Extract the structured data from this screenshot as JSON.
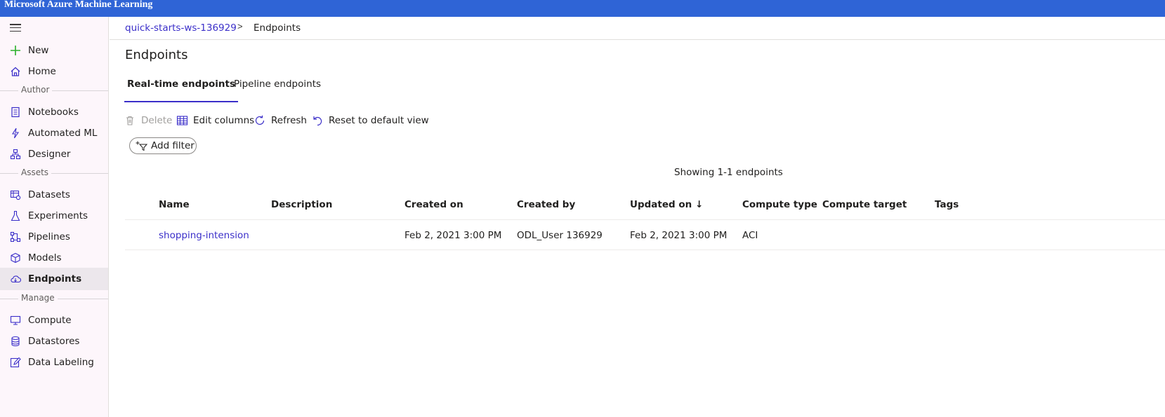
{
  "app": {
    "title": "Microsoft Azure Machine Learning"
  },
  "sidebar": {
    "new_label": "New",
    "home_label": "Home",
    "sections": {
      "author": "Author",
      "assets": "Assets",
      "manage": "Manage"
    },
    "author_items": [
      "Notebooks",
      "Automated ML",
      "Designer"
    ],
    "asset_items": [
      "Datasets",
      "Experiments",
      "Pipelines",
      "Models",
      "Endpoints"
    ],
    "manage_items": [
      "Compute",
      "Datastores",
      "Data Labeling"
    ],
    "active_item": "Endpoints"
  },
  "breadcrumb": {
    "workspace": "quick-starts-ws-136929",
    "separator": ">",
    "current": "Endpoints"
  },
  "page": {
    "title": "Endpoints"
  },
  "tabs": [
    {
      "label": "Real-time endpoints",
      "active": true
    },
    {
      "label": "Pipeline endpoints",
      "active": false
    }
  ],
  "toolbar": {
    "delete": "Delete",
    "edit_columns": "Edit columns",
    "refresh": "Refresh",
    "reset": "Reset to default view"
  },
  "filter": {
    "add_filter": "Add filter"
  },
  "table": {
    "showing": "Showing 1-1 endpoints",
    "columns": [
      "Name",
      "Description",
      "Created on",
      "Created by",
      "Updated on ↓",
      "Compute type",
      "Compute target",
      "Tags"
    ],
    "rows": [
      [
        "shopping-intension",
        "",
        "Feb 2, 2021 3:00 PM",
        "ODL_User 136929",
        "Feb 2, 2021 3:00 PM",
        "ACI",
        "",
        ""
      ]
    ]
  },
  "colors": {
    "topbar": "#2f64d6",
    "accent": "#3b2fc9",
    "new_plus": "#2bb02b"
  }
}
